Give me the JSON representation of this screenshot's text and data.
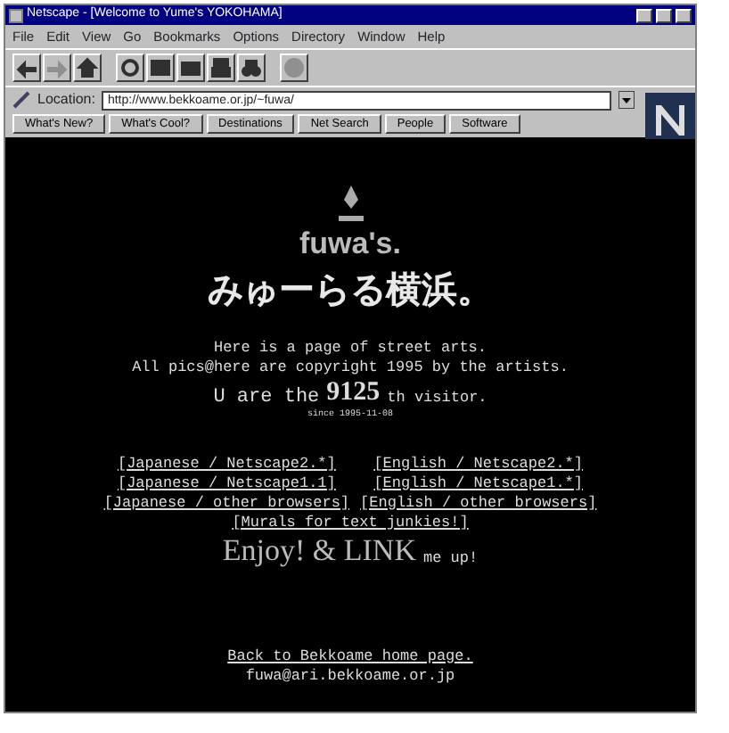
{
  "window": {
    "title": "Netscape - [Welcome to Yume's YOKOHAMA]"
  },
  "menu": [
    "File",
    "Edit",
    "View",
    "Go",
    "Bookmarks",
    "Options",
    "Directory",
    "Window",
    "Help"
  ],
  "toolbar": [
    {
      "kind": "back",
      "disabled": false
    },
    {
      "kind": "forward",
      "disabled": true
    },
    {
      "kind": "home",
      "disabled": false
    },
    {
      "kind": "reload",
      "disabled": false
    },
    {
      "kind": "images",
      "disabled": false
    },
    {
      "kind": "open",
      "disabled": false
    },
    {
      "kind": "print",
      "disabled": false
    },
    {
      "kind": "find",
      "disabled": false
    },
    {
      "kind": "stop",
      "disabled": true
    }
  ],
  "location": {
    "label": "Location:",
    "value": "http://www.bekkoame.or.jp/~fuwa/"
  },
  "directory_buttons": [
    "What's New?",
    "What's Cool?",
    "Destinations",
    "Net Search",
    "People",
    "Software"
  ],
  "page": {
    "brand": "fuwa's.",
    "headline": "みゅーらる横浜。",
    "intro": "Here is a page of street arts.",
    "copyright": "All pics@here are copyright 1995 by the artists.",
    "visitor": {
      "before": "U are the",
      "count": "9125",
      "after": "th visitor.",
      "since": "since 1995-11-08"
    },
    "links": [
      {
        "label": "[Japanese / Netscape2.*]"
      },
      {
        "label": "[English / Netscape2.*]"
      },
      {
        "label": "[Japanese / Netscape1.1]"
      },
      {
        "label": "[English / Netscape1.*]"
      },
      {
        "label": "[Japanese / other browsers]"
      },
      {
        "label": "[English / other browsers]"
      }
    ],
    "text_link": "[Murals for text junkies!]",
    "enjoy": {
      "big": "Enjoy! & LINK",
      "small": "me up!"
    },
    "footer_link": "Back to Bekkoame home page.",
    "email": "fuwa@ari.bekkoame.or.jp"
  }
}
